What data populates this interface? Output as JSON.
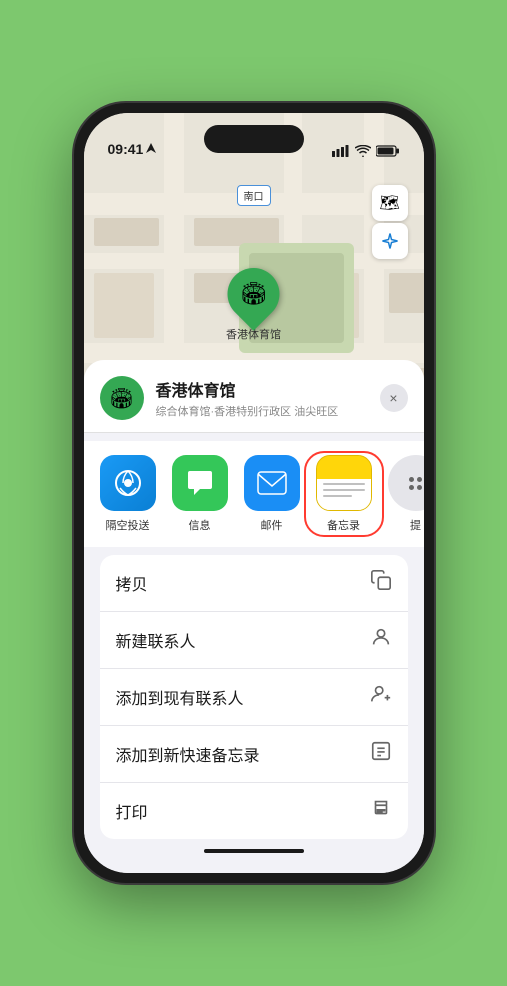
{
  "status_bar": {
    "time": "09:41",
    "location_arrow": "▶"
  },
  "map": {
    "label_top": "南口",
    "stadium_label": "香港体育馆",
    "control_layers": "🗺",
    "control_location": "➤"
  },
  "location_card": {
    "name": "香港体育馆",
    "detail": "综合体育馆·香港特别行政区 油尖旺区",
    "close_label": "×"
  },
  "share_apps": [
    {
      "id": "airdrop",
      "label": "隔空投送",
      "style": "airdrop"
    },
    {
      "id": "messages",
      "label": "信息",
      "style": "messages"
    },
    {
      "id": "mail",
      "label": "邮件",
      "style": "mail"
    },
    {
      "id": "notes",
      "label": "备忘录",
      "style": "notes",
      "selected": true
    },
    {
      "id": "more",
      "label": "提",
      "style": "more"
    }
  ],
  "actions": [
    {
      "id": "copy",
      "label": "拷贝",
      "icon": "⧉"
    },
    {
      "id": "new-contact",
      "label": "新建联系人",
      "icon": "👤"
    },
    {
      "id": "add-existing",
      "label": "添加到现有联系人",
      "icon": "👤"
    },
    {
      "id": "add-notes",
      "label": "添加到新快速备忘录",
      "icon": "📋"
    },
    {
      "id": "print",
      "label": "打印",
      "icon": "🖨"
    }
  ]
}
